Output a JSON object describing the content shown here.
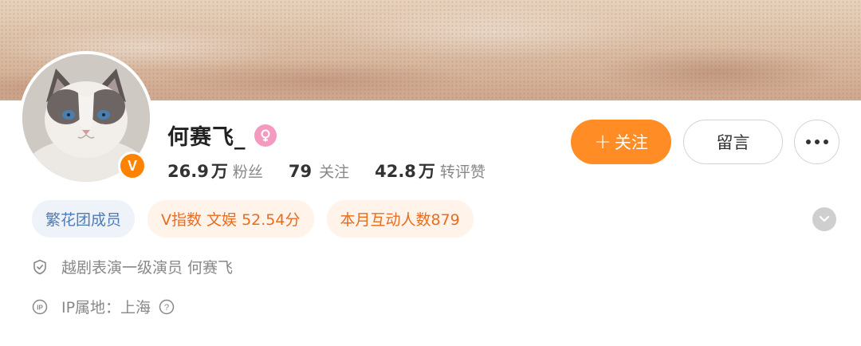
{
  "profile": {
    "name": "何赛飞_",
    "verified_badge": "V",
    "gender_icon": "female-icon",
    "stats": [
      {
        "value": "26.9",
        "unit": "万",
        "label": "粉丝"
      },
      {
        "value": "79",
        "unit": "",
        "label": "关注"
      },
      {
        "value": "42.8",
        "unit": "万",
        "label": "转评赞"
      }
    ]
  },
  "actions": {
    "follow_label": "关注",
    "follow_plus": "+",
    "message_label": "留言"
  },
  "tags": [
    {
      "label": "繁花团成员"
    },
    {
      "label": "V指数 文娱 52.54分"
    },
    {
      "label": "本月互动人数879"
    }
  ],
  "info": {
    "verification": "越剧表演一级演员 何赛飞",
    "ip_location": "IP属地：上海"
  },
  "colors": {
    "accent_orange": "#ff8c24",
    "badge_orange": "#ff8200",
    "tag_blue_text": "#4f7bb5",
    "tag_orange_text": "#ea6c1f",
    "gender_pink": "#f49ac1"
  }
}
